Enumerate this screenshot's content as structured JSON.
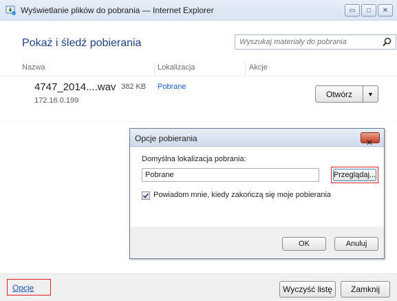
{
  "window": {
    "title": "Wyświetlanie plików do pobrania — Internet Explorer",
    "caption_buttons": [
      "minimize",
      "maximize",
      "close"
    ]
  },
  "header": {
    "title": "Pokaż i śledź pobierania",
    "search_placeholder": "Wyszukaj materiały do pobrania"
  },
  "columns": {
    "name": "Nazwa",
    "location": "Lokalizacja",
    "actions": "Akcje"
  },
  "download": {
    "file_name": "4747_2014....wav",
    "size": "382 KB",
    "location": "Pobrane",
    "host": "172.16.0.199",
    "open_label": "Otwórz"
  },
  "footer": {
    "options_link": "Opcje",
    "clear_label": "Wyczyść listę",
    "close_label": "Zamknij"
  },
  "dialog": {
    "title": "Opcje pobierania",
    "location_label": "Domyślna lokalizacja pobrania:",
    "location_value": "Pobrane",
    "browse_label": "Przeglądaj...",
    "notify_label": "Powiadom mnie, kiedy zakończą się moje pobierania",
    "notify_checked": true,
    "ok_label": "OK",
    "cancel_label": "Anuluj"
  },
  "colors": {
    "accent_title": "#1f3f84",
    "link": "#1f5fbf",
    "highlight_border": "#e02020"
  }
}
